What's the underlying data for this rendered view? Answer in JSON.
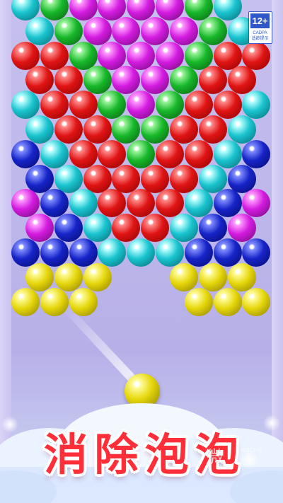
{
  "game": {
    "title_chars": [
      "消",
      "除",
      "泡",
      "泡"
    ],
    "age_rating": {
      "number": "12+",
      "org": "CADPA",
      "hint": "适龄提示"
    },
    "watermark": {
      "main": "微",
      "sub": "WXCHA"
    },
    "shooter_color": "yellow",
    "colors": {
      "red": "#e01414",
      "green": "#17b82a",
      "cyan": "#19c4cf",
      "purple": "#d41be0",
      "blue": "#1624c8",
      "yellow": "#e6d70c"
    },
    "bubble_rows": [
      [
        "cyan",
        "green",
        "purple",
        "purple",
        "purple",
        "purple",
        "green",
        "cyan",
        ""
      ],
      [
        "cyan",
        "green",
        "purple",
        "purple",
        "purple",
        "purple",
        "green",
        "cyan",
        ""
      ],
      [
        "red",
        "red",
        "green",
        "purple",
        "purple",
        "purple",
        "green",
        "red",
        "red"
      ],
      [
        "red",
        "red",
        "green",
        "purple",
        "purple",
        "green",
        "red",
        "red",
        ""
      ],
      [
        "cyan",
        "red",
        "red",
        "green",
        "purple",
        "green",
        "red",
        "red",
        "cyan"
      ],
      [
        "cyan",
        "red",
        "red",
        "green",
        "green",
        "red",
        "red",
        "cyan",
        ""
      ],
      [
        "blue",
        "cyan",
        "red",
        "red",
        "green",
        "red",
        "red",
        "cyan",
        "blue"
      ],
      [
        "blue",
        "cyan",
        "red",
        "red",
        "red",
        "red",
        "cyan",
        "blue",
        ""
      ],
      [
        "purple",
        "blue",
        "cyan",
        "red",
        "red",
        "red",
        "cyan",
        "blue",
        "purple"
      ],
      [
        "purple",
        "blue",
        "cyan",
        "red",
        "red",
        "cyan",
        "blue",
        "purple",
        ""
      ],
      [
        "blue",
        "blue",
        "blue",
        "cyan",
        "cyan",
        "cyan",
        "blue",
        "blue",
        "blue"
      ],
      [
        "yellow",
        "yellow",
        "yellow",
        "",
        "",
        "yellow",
        "yellow",
        "yellow",
        ""
      ],
      [
        "yellow",
        "yellow",
        "yellow",
        "",
        "",
        "",
        "yellow",
        "yellow",
        "yellow"
      ]
    ]
  }
}
